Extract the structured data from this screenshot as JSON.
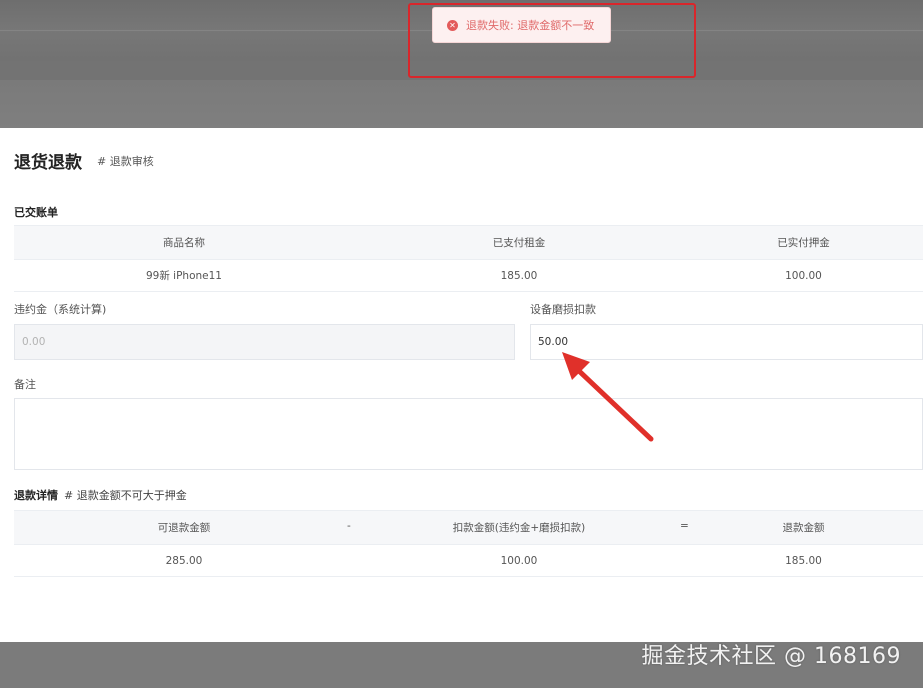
{
  "toast": {
    "message": "退款失败: 退款金额不一致",
    "icon": "error-circle-icon"
  },
  "page": {
    "title": "退货退款",
    "subtitle": "# 退款审核"
  },
  "paid_section": {
    "title": "已交账单",
    "columns": [
      "商品名称",
      "已支付租金",
      "已实付押金"
    ],
    "rows": [
      [
        "99新 iPhone11",
        "185.00",
        "100.00"
      ]
    ]
  },
  "form": {
    "penalty_label": "违约金（系统计算)",
    "penalty_value": "0.00",
    "wear_label": "设备磨损扣款",
    "wear_value": "50.00",
    "remark_label": "备注",
    "remark_value": ""
  },
  "refund_section": {
    "title": "退款详情",
    "note": "# 退款金额不可大于押金",
    "columns": [
      "可退款金额",
      "-",
      "扣款金额(违约金+磨损扣款)",
      "=",
      "退款金额"
    ],
    "rows": [
      [
        "285.00",
        "",
        "100.00",
        "",
        "185.00"
      ]
    ]
  },
  "watermark": "掘金技术社区 @ 168169",
  "colors": {
    "error": "#e35b5b",
    "annotation": "#d9262b"
  }
}
